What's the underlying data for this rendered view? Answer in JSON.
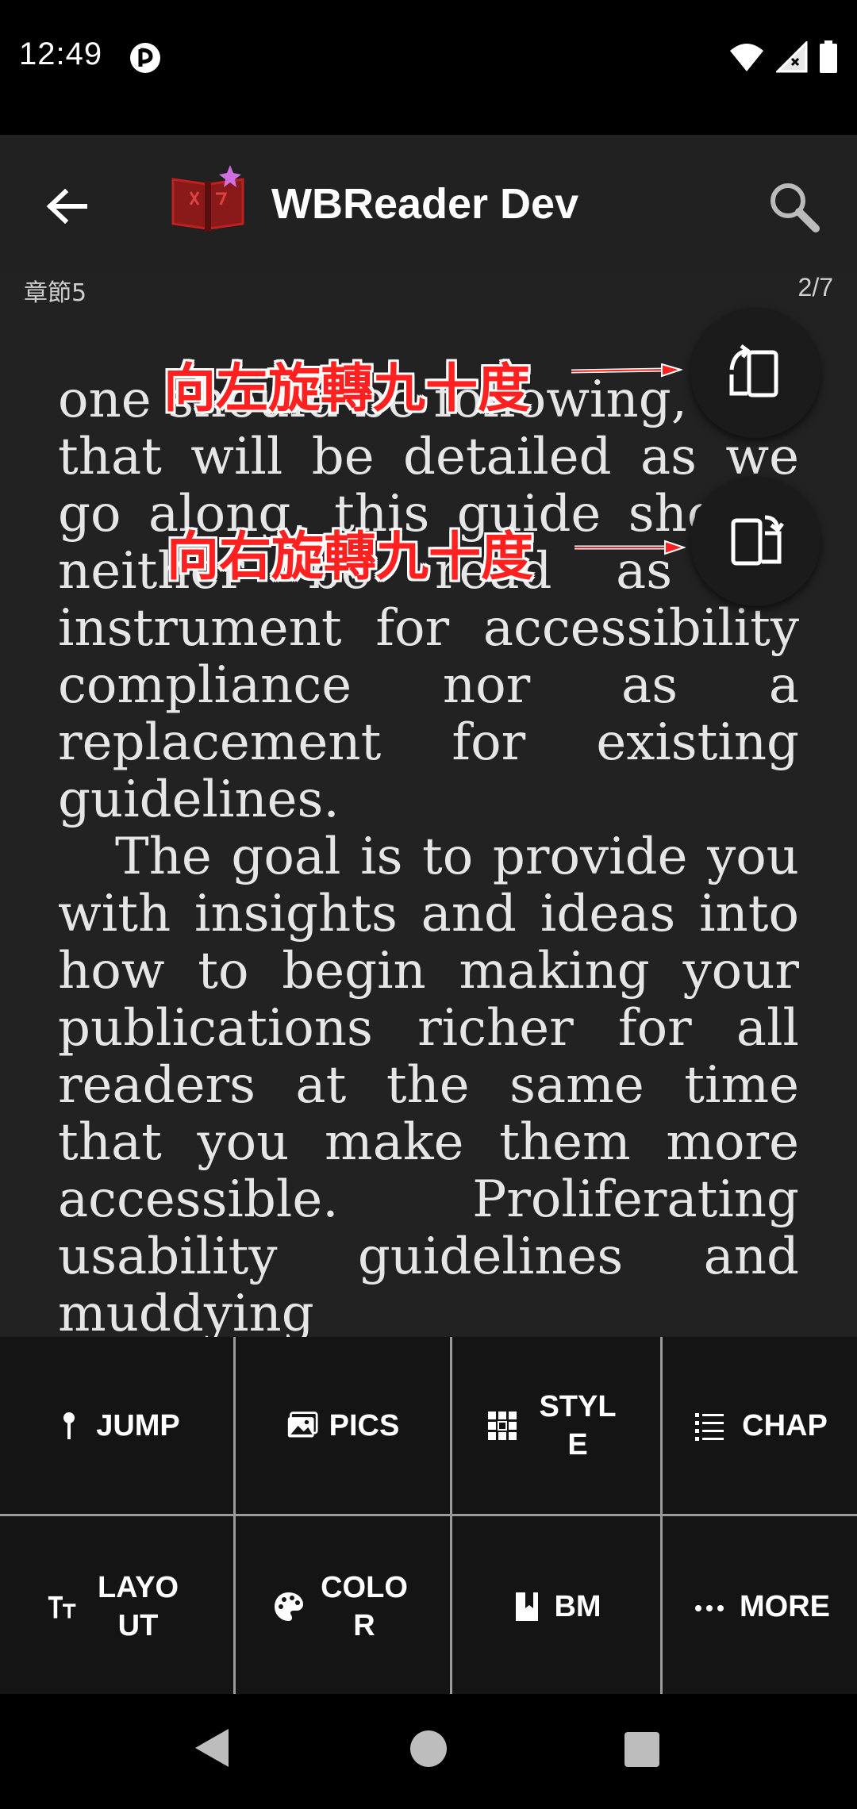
{
  "status_bar": {
    "time": "12:49",
    "icons": [
      "app-notification-icon",
      "wifi-icon",
      "signal-icon",
      "battery-icon"
    ]
  },
  "app_bar": {
    "title": "WBReader Dev",
    "back_icon": "arrow-left-icon",
    "search_icon": "search-icon"
  },
  "reader": {
    "chapter": "章節5",
    "page": "2/7",
    "paragraphs": [
      "one should be following, and that will be detailed as we go along, this guide should neither be read as an instrument for accessib­ility compliance nor as a replacement for existing guidelines.",
      "The goal is to provide you with insights and ideas into how to begin making your publications richer for all readers at the same time that you make them more accessible. Pro­liferating usability guidelines and muddying"
    ]
  },
  "annotations": {
    "rotate_left": "向左旋轉九十度",
    "rotate_right": "向右旋轉九十度"
  },
  "fabs": {
    "rotate_left_icon": "screen-rotate-left-icon",
    "rotate_right_icon": "screen-rotate-right-icon"
  },
  "toolbar": {
    "row1": [
      {
        "label": "JUMP",
        "icon": "pin-icon"
      },
      {
        "label": "PICS",
        "icon": "pictures-icon"
      },
      {
        "label": "STYLE",
        "icon": "grid-dots-icon"
      },
      {
        "label": "CHAP",
        "icon": "list-icon"
      }
    ],
    "row2": [
      {
        "label": "LAYOUT",
        "icon": "text-size-icon"
      },
      {
        "label": "COLOR",
        "icon": "palette-icon"
      },
      {
        "label": "BM",
        "icon": "bookmark-icon"
      },
      {
        "label": "MORE",
        "icon": "more-dots-icon"
      }
    ]
  },
  "nav_bar": {
    "icons": [
      "nav-back-icon",
      "nav-home-icon",
      "nav-recents-icon"
    ]
  }
}
